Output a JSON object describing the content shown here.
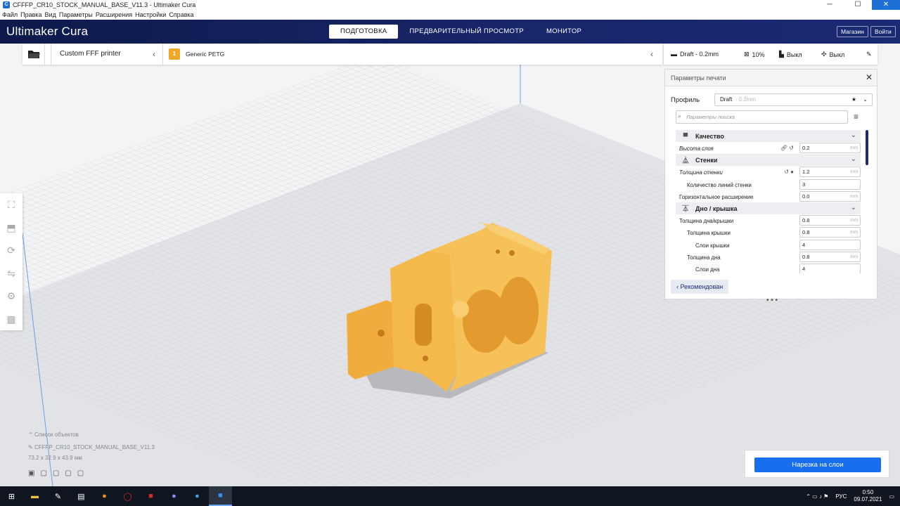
{
  "window": {
    "title": "CFFFP_CR10_STOCK_MANUAL_BASE_V11.3 - Ultimaker Cura",
    "min": "─",
    "max": "☐",
    "close": "✕"
  },
  "menu": [
    "Файл",
    "Правка",
    "Вид",
    "Параметры",
    "Расширения",
    "Настройки",
    "Справка"
  ],
  "header": {
    "logo_main": "Ultimaker",
    "logo_sub": "Cura",
    "tabs": [
      "ПОДГОТОВКА",
      "ПРЕДВАРИТЕЛЬНЫЙ ПРОСМОТР",
      "МОНИТОР"
    ],
    "active_tab": 0,
    "marketplace": "Магазин",
    "signin": "Войти"
  },
  "stage": {
    "printer": "Custom FFF printer",
    "material_badge": "1",
    "material": "Generic PETG",
    "profile_summary": "Draft - 0.2mm",
    "infill": "10%",
    "support": "Выкл",
    "adhesion": "Выкл"
  },
  "panel": {
    "title": "Параметры печати",
    "profile_label": "Профиль",
    "profile_value": "Draft",
    "profile_sub": "- 0.2mm",
    "search_placeholder": "Параметры поиска",
    "recommended": "Рекомендован",
    "categories": [
      {
        "name": "Качество",
        "icon": "quality-icon"
      },
      {
        "name": "Стенки",
        "icon": "walls-icon"
      },
      {
        "name": "Дно / крышка",
        "icon": "topbottom-icon"
      }
    ],
    "rows": {
      "layer_height": {
        "name": "Высота слоя",
        "value": "0.2",
        "unit": "mm"
      },
      "wall_thickness": {
        "name": "Толщина стенки",
        "value": "1.2",
        "unit": "mm"
      },
      "wall_line_count": {
        "name": "Количество линий стенки",
        "value": "3"
      },
      "horizontal_expansion": {
        "name": "Горизонтальное расширение",
        "value": "0.0",
        "unit": "mm"
      },
      "top_bottom_thickness": {
        "name": "Толщина дна/крышки",
        "value": "0.8",
        "unit": "mm"
      },
      "top_thickness": {
        "name": "Толщина крышки",
        "value": "0.8",
        "unit": "mm"
      },
      "top_layers": {
        "name": "Слои крышки",
        "value": "4"
      },
      "bottom_thickness": {
        "name": "Толщина дна",
        "value": "0.8",
        "unit": "mm"
      },
      "bottom_layers": {
        "name": "Слои дна",
        "value": "4"
      }
    }
  },
  "object_info": {
    "list_label": "Список объектов",
    "name": "CFFFP_CR10_STOCK_MANUAL_BASE_V11.3",
    "dims": "73.2 x 32.9 x 43.9 мм"
  },
  "slice_button": "Нарезка на слои",
  "taskbar": {
    "lang": "РУС",
    "time": "0:50",
    "date": "09.07.2021"
  },
  "colors": {
    "header": "#1a2a73",
    "accent": "#196ef0",
    "model": "#f5b84a"
  }
}
